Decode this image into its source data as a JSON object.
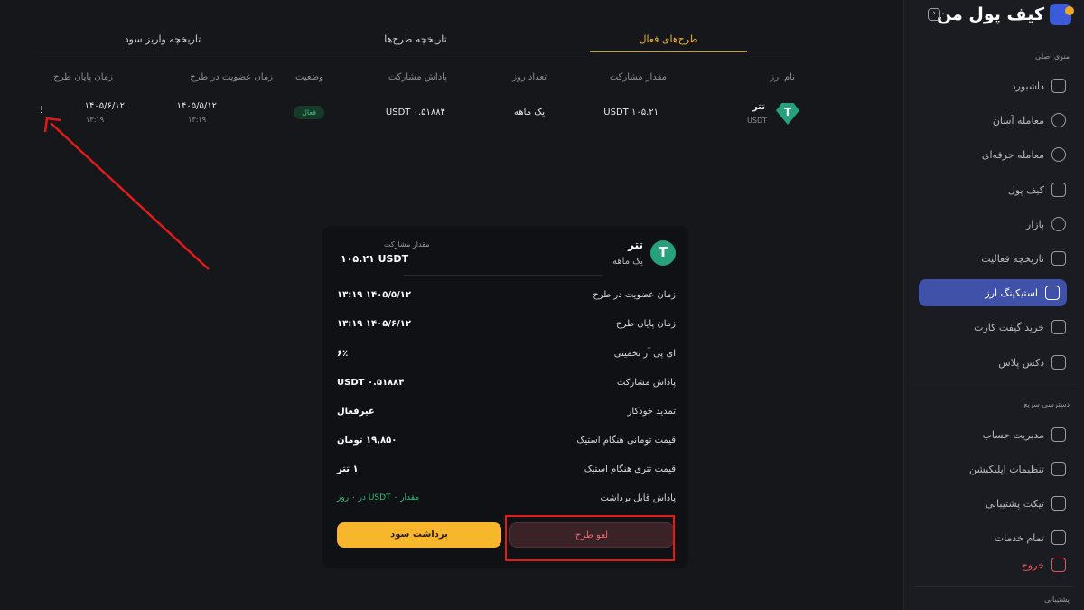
{
  "brand": {
    "name": "کیف پول من"
  },
  "sidebar": {
    "section_main": "منوی اصلی",
    "items": [
      {
        "label": "داشبورد",
        "icon": "dashboard-icon"
      },
      {
        "label": "معامله آسان",
        "icon": "easy-trade-icon"
      },
      {
        "label": "معامله حرفه‌ای",
        "icon": "pro-trade-icon"
      },
      {
        "label": "کیف پول",
        "icon": "wallet-icon"
      },
      {
        "label": "بازار",
        "icon": "market-icon"
      },
      {
        "label": "تاریخچه فعالیت",
        "icon": "history-icon"
      },
      {
        "label": "استیکینگ ارز",
        "icon": "staking-icon",
        "active": true
      },
      {
        "label": "خرید گیفت کارت",
        "icon": "gift-card-icon"
      },
      {
        "label": "دکس پلاس",
        "icon": "dex-plus-icon"
      }
    ],
    "section_quick": "دسترسی سریع",
    "quick_items": [
      {
        "label": "مدیریت حساب",
        "icon": "account-icon"
      },
      {
        "label": "تنظیمات اپلیکیشن",
        "icon": "settings-icon"
      },
      {
        "label": "تیکت پشتیبانی",
        "icon": "ticket-icon"
      },
      {
        "label": "تمام خدمات",
        "icon": "all-services-icon"
      },
      {
        "label": "خروج",
        "icon": "logout-icon"
      }
    ],
    "section_support": "پشتیبانی"
  },
  "tabs": {
    "active": "طرح‌های فعال",
    "history": "تاریخچه طرح‌ها",
    "payouts": "تاریخچه واریز سود"
  },
  "table": {
    "headers": {
      "coin": "نام ارز",
      "amount": "مقدار مشارکت",
      "days": "تعداد روز",
      "reward": "پاداش مشارکت",
      "status": "وضعیت",
      "join": "زمان عضویت در طرح",
      "end": "زمان پایان طرح"
    },
    "rows": [
      {
        "coin_name": "تتر",
        "coin_symbol": "USDT",
        "amount": "۱۰۵.۲۱ USDT",
        "days": "یک ماهه",
        "reward": "۰.۵۱۸۸۴ USDT",
        "status": "فعال",
        "join_date": "۱۴۰۵/۵/۱۲",
        "join_time": "۱۳:۱۹",
        "end_date": "۱۴۰۵/۶/۱۲",
        "end_time": "۱۳:۱۹"
      }
    ]
  },
  "modal": {
    "coin_name": "تتر",
    "period": "یک ماهه",
    "amount_label": "مقدار مشارکت",
    "amount": "۱۰۵.۲۱ USDT",
    "rows": [
      {
        "label": "زمان عضویت در طرح",
        "value": "۱۴۰۵/۵/۱۲   ۱۳:۱۹"
      },
      {
        "label": "زمان پایان طرح",
        "value": "۱۴۰۵/۶/۱۲   ۱۳:۱۹"
      },
      {
        "label": "ای پی آر تخمینی",
        "value": "۶٪"
      },
      {
        "label": "پاداش مشارکت",
        "value": "۰.۵۱۸۸۴ USDT"
      },
      {
        "label": "تمدید خودکار",
        "value": "غیرفعال"
      },
      {
        "label": "قیمت تومانی هنگام استیک",
        "value": "۱۹,۸۵۰ تومان"
      },
      {
        "label": "قیمت تتری هنگام استیک",
        "value": "۱ تتر"
      },
      {
        "label": "پاداش قابل برداشت",
        "value": "مقدار ۰ USDT در ۰ روز"
      }
    ],
    "cancel_label": "لغو طرح",
    "withdraw_label": "برداشت سود"
  },
  "colors": {
    "accent": "#f8b62c",
    "active_nav": "#3f51a8",
    "danger": "#e01b1b",
    "usdt": "#26a17b"
  }
}
